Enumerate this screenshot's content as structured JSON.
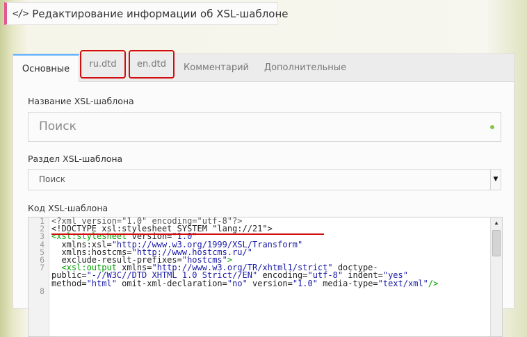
{
  "header": {
    "icon": "code-icon",
    "icon_glyph": "</>",
    "title": "Редактирование информации об XSL-шаблоне",
    "accent_color": "#e25a8e"
  },
  "tabs": [
    {
      "label": "Основные",
      "active": true
    },
    {
      "label": "ru.dtd",
      "highlighted": true
    },
    {
      "label": "en.dtd",
      "highlighted": true
    },
    {
      "label": "Комментарий"
    },
    {
      "label": "Дополнительные"
    }
  ],
  "form": {
    "name_label": "Название XSL-шаблона",
    "name_placeholder": "Поиск",
    "section_label": "Раздел XSL-шаблона",
    "section_value": "Поиск",
    "code_label": "Код XSL-шаблона"
  },
  "editor": {
    "line_numbers": [
      "1",
      "2",
      "3",
      "4",
      "5",
      "6",
      "7",
      "8"
    ],
    "lines": [
      {
        "parts": [
          {
            "t": "<?xml version=\"1.0\" encoding=\"utf-8\"?>",
            "c": "c-grey"
          }
        ]
      },
      {
        "parts": [
          {
            "t": "<!DOCTYPE xsl:stylesheet SYSTEM \"lang://21\">",
            "c": "c-black"
          }
        ]
      },
      {
        "parts": [
          {
            "t": "<xsl:stylesheet",
            "c": "c-green"
          },
          {
            "t": " version=",
            "c": "c-black"
          },
          {
            "t": "\"1.0\"",
            "c": "c-blue"
          }
        ]
      },
      {
        "parts": [
          {
            "t": "  xmlns:xsl=",
            "c": "c-black"
          },
          {
            "t": "\"http://www.w3.org/1999/XSL/Transform\"",
            "c": "c-blue"
          }
        ]
      },
      {
        "parts": [
          {
            "t": "  xmlns:hostcms=",
            "c": "c-black"
          },
          {
            "t": "\"http://www.hostcms.ru/\"",
            "c": "c-blue"
          }
        ]
      },
      {
        "parts": [
          {
            "t": "  exclude-result-prefixes=",
            "c": "c-black"
          },
          {
            "t": "\"hostcms\"",
            "c": "c-blue"
          },
          {
            "t": ">",
            "c": "c-green"
          }
        ]
      },
      {
        "parts": [
          {
            "t": "  <xsl:output",
            "c": "c-green"
          },
          {
            "t": " xmlns=",
            "c": "c-black"
          },
          {
            "t": "\"http://www.w3.org/TR/xhtml1/strict\"",
            "c": "c-blue"
          },
          {
            "t": " doctype-",
            "c": "c-black"
          }
        ]
      },
      {
        "parts": [
          {
            "t": "public=",
            "c": "c-black"
          },
          {
            "t": "\"-//W3C//DTD XHTML 1.0 Strict//EN\"",
            "c": "c-blue"
          },
          {
            "t": " encoding=",
            "c": "c-black"
          },
          {
            "t": "\"utf-8\"",
            "c": "c-blue"
          },
          {
            "t": " indent=",
            "c": "c-black"
          },
          {
            "t": "\"yes\"",
            "c": "c-blue"
          }
        ]
      },
      {
        "parts": [
          {
            "t": "method=",
            "c": "c-black"
          },
          {
            "t": "\"html\"",
            "c": "c-blue"
          },
          {
            "t": " omit-xml-declaration=",
            "c": "c-black"
          },
          {
            "t": "\"no\"",
            "c": "c-blue"
          },
          {
            "t": " version=",
            "c": "c-black"
          },
          {
            "t": "\"1.0\"",
            "c": "c-blue"
          },
          {
            "t": " media-type=",
            "c": "c-black"
          },
          {
            "t": "\"text/xml\"",
            "c": "c-blue"
          },
          {
            "t": "/>",
            "c": "c-green"
          }
        ]
      },
      {
        "parts": [
          {
            "t": "",
            "c": "c-black"
          }
        ]
      }
    ]
  },
  "colors": {
    "highlight_red": "#d10d0d",
    "active_tab_accent": "#5db2ff",
    "status_dot": "#8bc34a"
  }
}
